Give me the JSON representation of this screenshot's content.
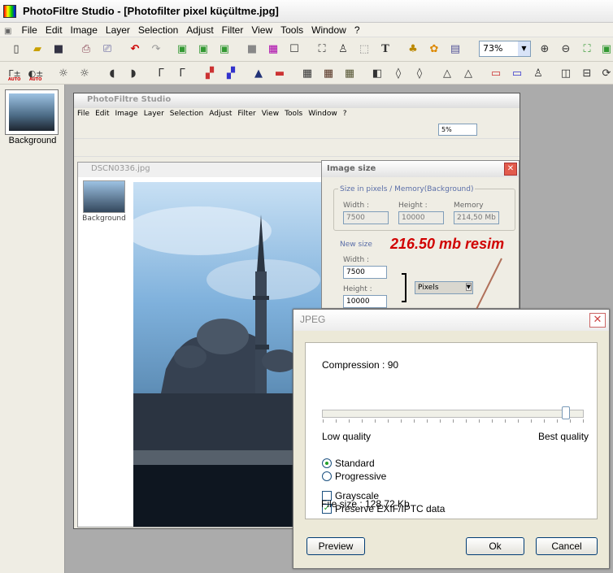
{
  "app": {
    "title": "PhotoFiltre Studio - [Photofilter pixel küçültme.jpg]"
  },
  "menu": [
    "File",
    "Edit",
    "Image",
    "Layer",
    "Selection",
    "Adjust",
    "Filter",
    "View",
    "Tools",
    "Window",
    "?"
  ],
  "toolbar": {
    "zoom": "73%"
  },
  "toolbar2_labels": {
    "auto1": "AUTO",
    "auto2": "AUTO"
  },
  "layers": {
    "thumb_label": "Background"
  },
  "inner": {
    "title": "PhotoFiltre Studio",
    "menu": [
      "File",
      "Edit",
      "Image",
      "Layer",
      "Selection",
      "Adjust",
      "Filter",
      "View",
      "Tools",
      "Window",
      "?"
    ],
    "zoom": "5%",
    "doc_title": "DSCN0336.jpg",
    "doc_thumb_label": "Background"
  },
  "image_size": {
    "title": "Image size",
    "group1": "Size in pixels / Memory(Background)",
    "width_label": "Width :",
    "height_label": "Height :",
    "memory_label": "Memory",
    "width": "7500",
    "height": "10000",
    "memory": "214,50 Mb",
    "group2": "New size",
    "new_width_label": "Width :",
    "new_height_label": "Height :",
    "new_width": "7500",
    "new_height": "10000",
    "unit": "Pixels"
  },
  "annotation": {
    "text": "216.50 mb resim",
    "color": "#d00000"
  },
  "jpeg": {
    "title": "JPEG",
    "compression": "Compression : 90",
    "compression_value": 90,
    "low_quality": "Low quality",
    "best_quality": "Best quality",
    "standard": "Standard",
    "progressive": "Progressive",
    "grayscale": "Grayscale",
    "preserve": "Preserve EXIF/IPTC data",
    "file_size": "File size : 128,72 Kb",
    "preview": "Preview",
    "ok": "Ok",
    "cancel": "Cancel"
  }
}
